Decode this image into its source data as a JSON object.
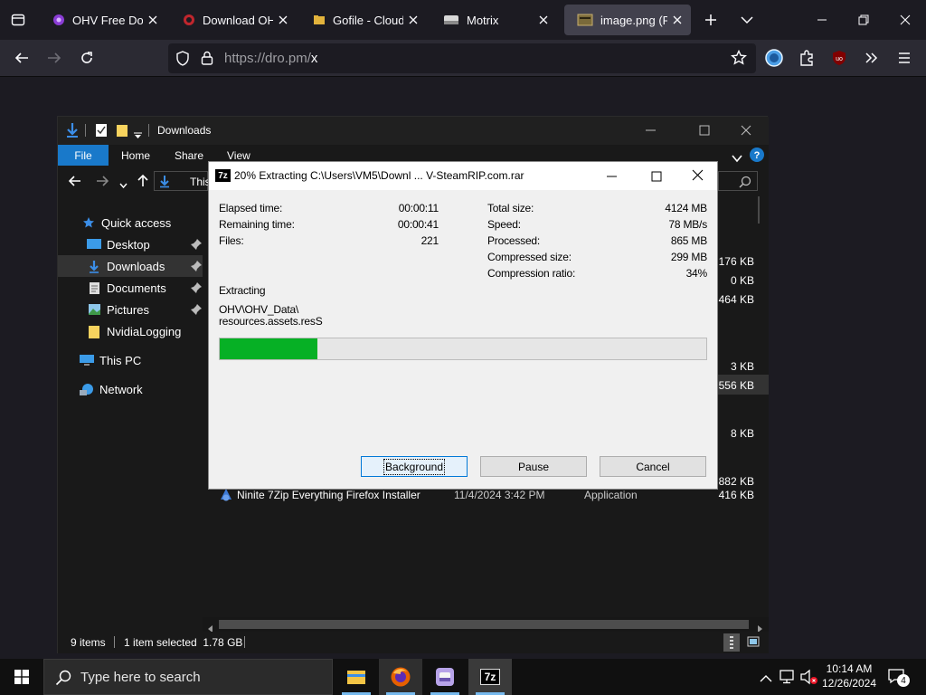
{
  "browser": {
    "tabs": [
      {
        "title": "OHV Free Down",
        "favicon": "purple-swirl-icon"
      },
      {
        "title": "Download OHV",
        "favicon": "red-circle-icon"
      },
      {
        "title": "Gofile - Cloud S",
        "favicon": "folder-icon"
      },
      {
        "title": "Motrix",
        "favicon": "motrix-icon"
      },
      {
        "title": "image.png (PNG",
        "favicon": "image-icon",
        "active": true
      }
    ],
    "url_host": "https://dro.pm/",
    "url_path": "x"
  },
  "explorer": {
    "title": "Downloads",
    "ribbon": {
      "file": "File",
      "home": "Home",
      "share": "Share",
      "view": "View"
    },
    "address": "This",
    "nav": {
      "quick_access": "Quick access",
      "desktop": "Desktop",
      "downloads": "Downloads",
      "documents": "Documents",
      "pictures": "Pictures",
      "nvidia": "NvidiaLogging",
      "this_pc": "This PC",
      "network": "Network"
    },
    "sizes": [
      "176 KB",
      "0 KB",
      "464 KB",
      "3 KB",
      "556 KB",
      "8 KB",
      "882 KB"
    ],
    "last_row": {
      "name": "Ninite 7Zip Everything Firefox Installer",
      "date": "11/4/2024 3:42 PM",
      "type": "Application",
      "size": "416 KB"
    },
    "status": {
      "items": "9 items",
      "selected": "1 item selected  1.78 GB"
    }
  },
  "dialog": {
    "title": "20% Extracting C:\\Users\\VM5\\Downl ... V-SteamRIP.com.rar",
    "left": [
      {
        "label": "Elapsed time:",
        "value": "00:00:11"
      },
      {
        "label": "Remaining time:",
        "value": "00:00:41"
      },
      {
        "label": "Files:",
        "value": "221"
      }
    ],
    "right": [
      {
        "label": "Total size:",
        "value": "4124 MB"
      },
      {
        "label": "Speed:",
        "value": "78 MB/s"
      },
      {
        "label": "Processed:",
        "value": "865 MB"
      },
      {
        "label": "Compressed size:",
        "value": "299 MB"
      },
      {
        "label": "Compression ratio:",
        "value": "34%"
      }
    ],
    "extracting_label": "Extracting",
    "path_line1": "OHV\\OHV_Data\\",
    "path_line2": "resources.assets.resS",
    "progress": 0.2,
    "buttons": {
      "background": "Background",
      "pause": "Pause",
      "cancel": "Cancel"
    }
  },
  "taskbar": {
    "search_placeholder": "Type here to search",
    "time": "10:14 AM",
    "date": "12/26/2024",
    "notification_count": "4"
  }
}
